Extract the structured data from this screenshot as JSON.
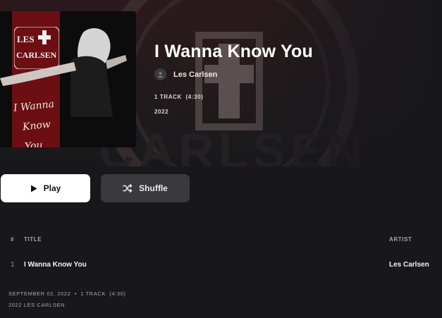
{
  "album": {
    "title": "I Wanna Know You",
    "artist": "Les Carlsen",
    "track_summary": "1 TRACK  (4:30)",
    "year": "2022",
    "cover_logo_text": [
      "LES",
      "CARLSEN"
    ],
    "cover_script": [
      "I Wanna",
      "Know You"
    ]
  },
  "buttons": {
    "play_label": "Play",
    "shuffle_label": "Shuffle"
  },
  "tracklist": {
    "columns": {
      "number": "#",
      "title": "TITLE",
      "artist": "ARTIST"
    },
    "rows": [
      {
        "number": "1",
        "title": "I Wanna Know You",
        "artist": "Les Carlsen"
      }
    ]
  },
  "footer": {
    "release_line": "SEPTEMBER 02, 2022  •  1 TRACK  (4:30)",
    "copyright": "2022 LES CARLSEN"
  },
  "colors": {
    "background": "#18181b",
    "play_button": "#ffffff",
    "shuffle_button": "#3a3a3e",
    "cover_accent": "#6b0f12"
  },
  "icons": [
    "play-icon",
    "shuffle-icon",
    "artist-avatar-icon"
  ]
}
